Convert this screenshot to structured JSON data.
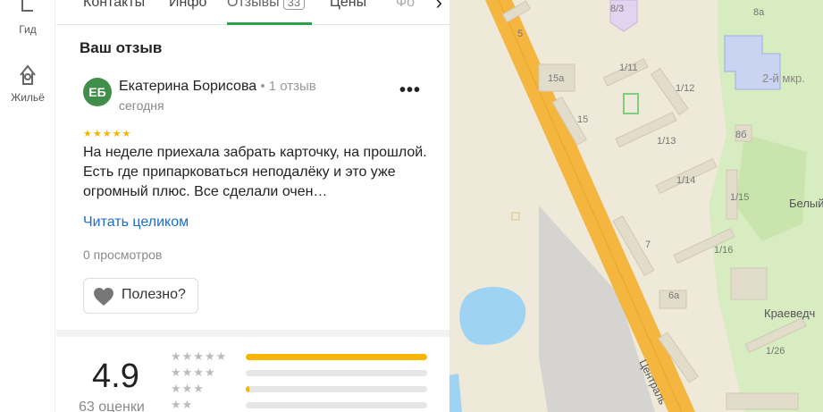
{
  "rail": {
    "items": [
      {
        "label": "Гид"
      },
      {
        "label": "Жильё"
      }
    ]
  },
  "tabs": {
    "items": [
      {
        "label": "Контакты"
      },
      {
        "label": "Инфо"
      },
      {
        "label": "Отзывы"
      },
      {
        "label": "Цены"
      },
      {
        "label": "Фо"
      }
    ],
    "reviews_badge": "33",
    "next_arrow": "›"
  },
  "review": {
    "section_title": "Ваш отзыв",
    "avatar_initials": "ЕБ",
    "author": "Екатерина Борисова",
    "author_meta": " • 1 отзыв",
    "date": "сегодня",
    "more": "•••",
    "stars": "★★★★★",
    "text": "На неделе приехала забрать карточку, на прошлой. Есть где припарковаться неподалёку и это уже огромный плюс. Все сделали очен…",
    "read_more": "Читать целиком",
    "views": "0 просмотров",
    "useful_label": "Полезно?"
  },
  "rating": {
    "value": "4.9",
    "count": "63 оценки",
    "distribution": [
      {
        "stars": "★★★★★",
        "fraction": 1.0
      },
      {
        "stars": "★★★★",
        "fraction": 0.0
      },
      {
        "stars": "★★★",
        "fraction": 0.02
      },
      {
        "stars": "★★",
        "fraction": 0.0
      }
    ]
  },
  "map": {
    "labels": [
      {
        "text": "8/3"
      },
      {
        "text": "8а"
      },
      {
        "text": "5"
      },
      {
        "text": "15а"
      },
      {
        "text": "1/11"
      },
      {
        "text": "1/12"
      },
      {
        "text": "15"
      },
      {
        "text": "1/13"
      },
      {
        "text": "8б"
      },
      {
        "text": "1/14"
      },
      {
        "text": "1/15"
      },
      {
        "text": "7"
      },
      {
        "text": "1/16"
      },
      {
        "text": "6а"
      },
      {
        "text": "1/26"
      },
      {
        "text": "2-й мкр."
      },
      {
        "text": "Белый"
      },
      {
        "text": "Краеведч"
      },
      {
        "text": "Централь"
      }
    ]
  },
  "colors": {
    "accent_green": "#2aa04a",
    "star_yellow": "#f7b500",
    "link_blue": "#1a6dcc",
    "road_orange": "#f4b63f",
    "water_blue": "#9fd3f3",
    "park_green": "#d7ecc0"
  }
}
